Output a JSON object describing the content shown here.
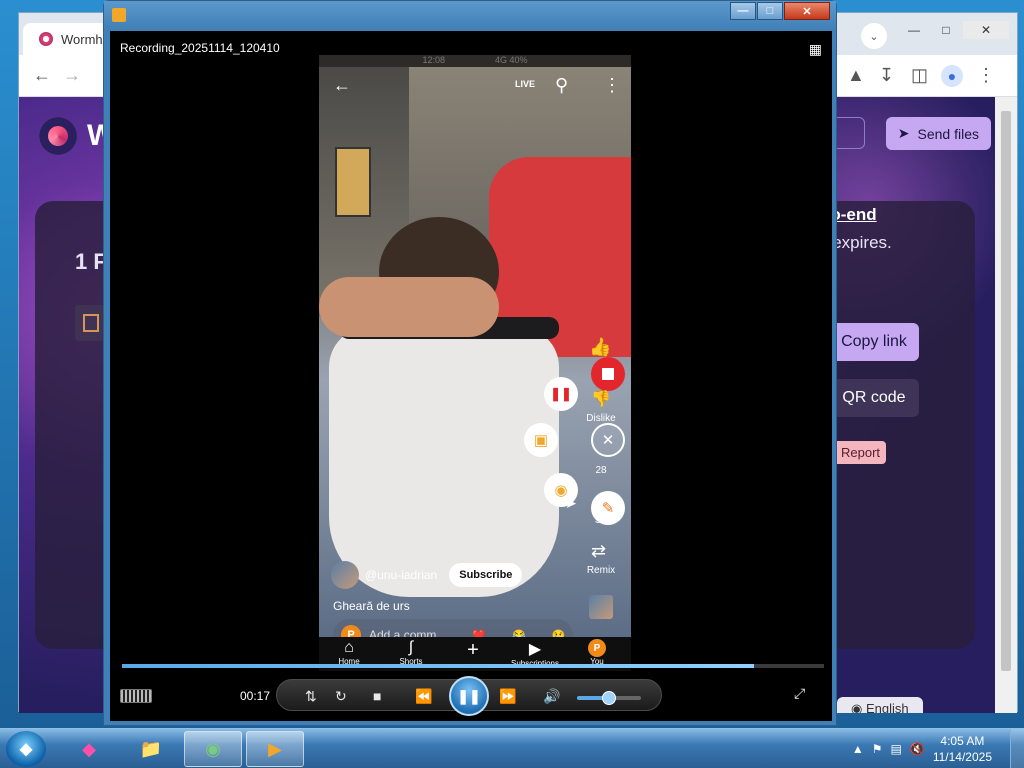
{
  "browser": {
    "tab_title": "Wormh",
    "page": {
      "logo_letter": "W",
      "send_files_label": "Send files",
      "heading": "1 F",
      "e2e_text": "-to-end",
      "expires_text": "y expires.",
      "copy_link_label": "Copy link",
      "qr_code_label": "QR code",
      "report_label": "Report",
      "language_label": "English"
    }
  },
  "player": {
    "filename": "Recording_20251114_120410",
    "time_elapsed": "00:17",
    "progress": 0.9,
    "volume": 0.5
  },
  "video": {
    "status_time": "12:08",
    "status_right": "4G 40%",
    "top_live": "LIVE",
    "actions": {
      "dislike_label": "Dislike",
      "count": "28",
      "share_label": "Sh",
      "remix_label": "Remix"
    },
    "channel_handle": "@unu-iadrian",
    "subscribe_label": "Subscribe",
    "caption": "Gheară de urs",
    "comment_placeholder": "Add a comm...",
    "comment_avatar": "P",
    "emoji_reactions": [
      "❤️",
      "😂",
      "😢"
    ],
    "nav": {
      "home": "Home",
      "shorts": "Shorts",
      "subscriptions": "Subscriptions",
      "you": "You",
      "you_avatar": "P"
    }
  },
  "taskbar": {
    "time": "4:05 AM",
    "date": "11/14/2025"
  },
  "colors": {
    "record_red": "#e3262c",
    "player_orange": "#f2a72b",
    "accent_purple": "#c6a8f2"
  }
}
